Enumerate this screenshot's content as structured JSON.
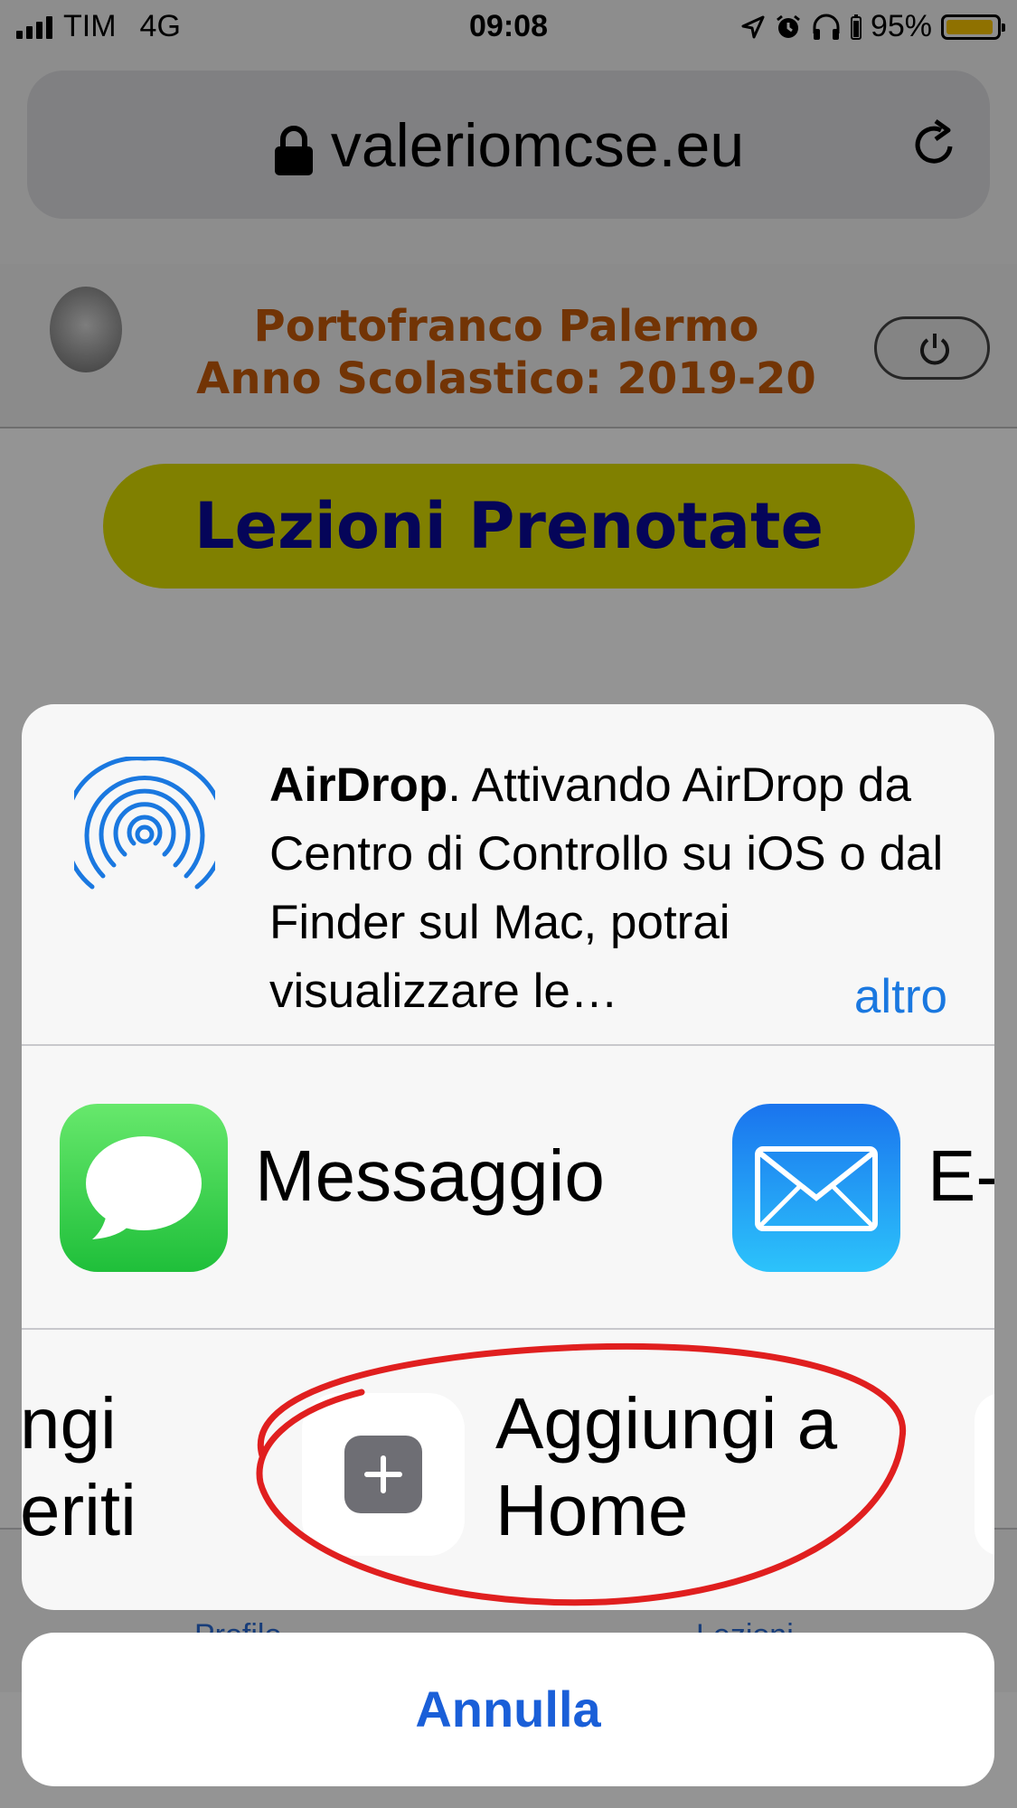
{
  "status_bar": {
    "carrier": "TIM",
    "network": "4G",
    "time": "09:08",
    "battery_percent": "95%",
    "battery_level": 0.95
  },
  "browser": {
    "url": "valeriomcse.eu"
  },
  "site": {
    "title_line1": "Portofranco Palermo",
    "title_line2": "Anno Scolastico: 2019-20",
    "main_button": "Lezioni Prenotate",
    "tabs": [
      {
        "label": "Profilo"
      },
      {
        "label": "Lezioni"
      }
    ]
  },
  "share_sheet": {
    "airdrop": {
      "bold": "AirDrop",
      "text": ". Attivando AirDrop da Centro di Controllo su iOS o dal Finder sul Mac, potrai visualizzare le…",
      "more": "altro"
    },
    "apps": [
      {
        "label": "Messaggio",
        "icon": "messages-icon"
      },
      {
        "label": "E-",
        "icon": "mail-icon"
      }
    ],
    "actions": [
      {
        "label_line1": "ngi",
        "label_line2": "eriti"
      },
      {
        "label_line1": "Aggiungi a",
        "label_line2": "Home",
        "icon": "plus-icon"
      }
    ],
    "cancel": "Annulla"
  },
  "colors": {
    "header_title": "#c45a0a",
    "main_button_bg": "#dddd00",
    "main_button_text": "#0a0a9a",
    "link_blue": "#1a78e0",
    "annotation_red": "#e01f1f"
  }
}
